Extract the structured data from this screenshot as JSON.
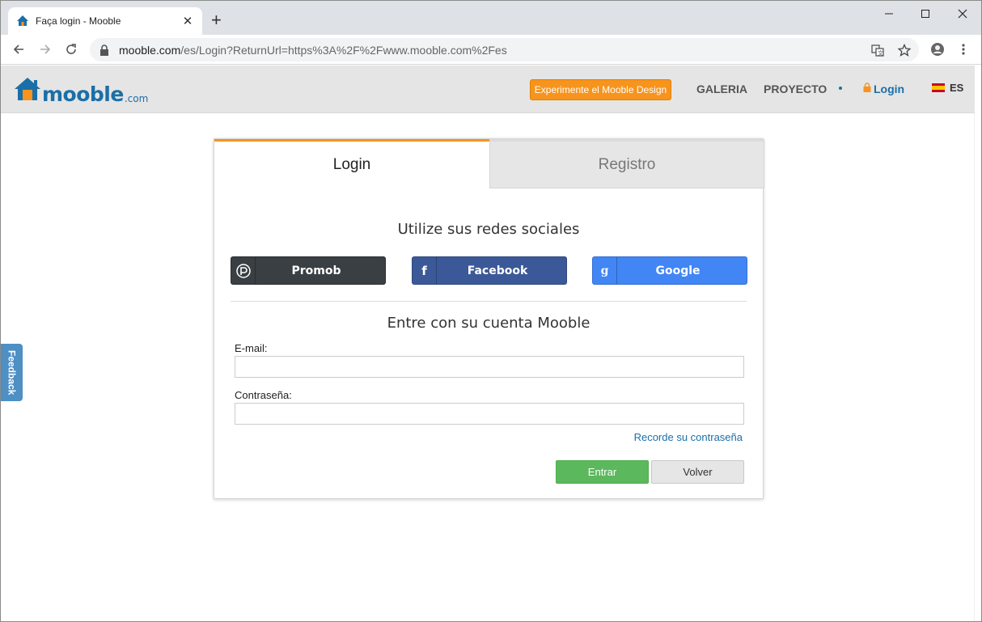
{
  "browser": {
    "tab_title": "Faça login - Mooble",
    "url_host": "mooble.com",
    "url_rest": "/es/Login?ReturnUrl=https%3A%2F%2Fwww.mooble.com%2Fes"
  },
  "header": {
    "logo_text": "mooble",
    "logo_suffix": ".com",
    "promo_label": "Experimente el Mooble Design",
    "nav": [
      "GALERIA",
      "PROYECTO"
    ],
    "login_label": "Login",
    "lang_label": "ES"
  },
  "feedback_label": "Feedback",
  "card": {
    "tab_login": "Login",
    "tab_register": "Registro",
    "social_title": "Utilize sus redes sociales",
    "social": [
      {
        "label": "Promob",
        "icon": "promob-icon",
        "color": "#3a3f44"
      },
      {
        "label": "Facebook",
        "icon": "facebook-icon",
        "color": "#3b5998"
      },
      {
        "label": "Google",
        "icon": "google-icon",
        "color": "#4285f4"
      }
    ],
    "account_title": "Entre con su cuenta Mooble",
    "email_label": "E-mail:",
    "email_value": "",
    "password_label": "Contraseña:",
    "password_value": "",
    "forgot_label": "Recorde su contraseña",
    "enter_label": "Entrar",
    "back_label": "Volver"
  },
  "colors": {
    "accent": "#f7941d",
    "brand": "#1b6fa8",
    "success": "#5cb85c"
  }
}
